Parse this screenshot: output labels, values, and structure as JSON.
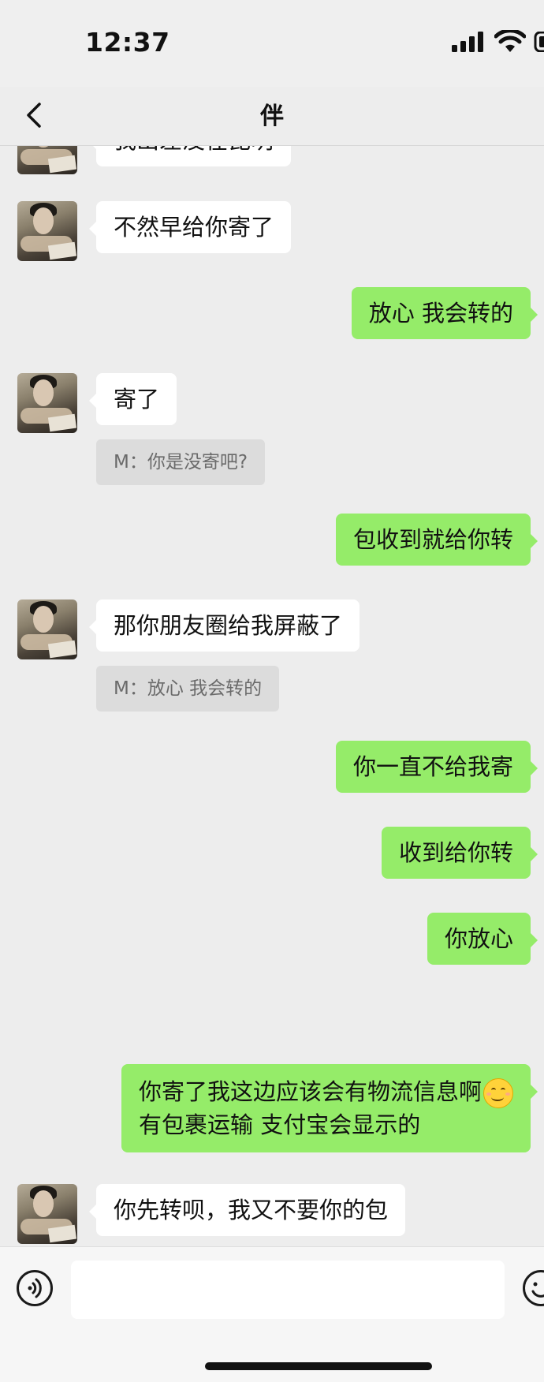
{
  "status_bar": {
    "time": "12:37"
  },
  "header": {
    "title": "伴",
    "back_icon": "chevron-left-icon"
  },
  "messages": [
    {
      "side": "in",
      "text": "我出差没在昆明",
      "cut": true
    },
    {
      "side": "in",
      "text": "不然早给你寄了"
    },
    {
      "side": "out",
      "text": "放心 我会转的"
    },
    {
      "side": "in",
      "text": "寄了",
      "quote": "M：你是没寄吧?"
    },
    {
      "side": "out",
      "text": "包收到就给你转"
    },
    {
      "side": "in",
      "text": "那你朋友圈给我屏蔽了",
      "quote": "M：放心 我会转的"
    },
    {
      "side": "out",
      "text": "你一直不给我寄"
    },
    {
      "side": "out",
      "text": "收到给你转"
    },
    {
      "side": "out",
      "text": "你放心"
    },
    {
      "side": "out",
      "line1": "你寄了我这边应该会有物流信息啊",
      "line2": "有包裹运输 支付宝会显示的",
      "emoji": "smiling-face-emoji"
    },
    {
      "side": "in",
      "text": "你先转呗，我又不要你的包"
    }
  ],
  "input_bar": {
    "voice_icon": "voice-icon",
    "emoji_icon": "emoji-icon",
    "placeholder": ""
  },
  "colors": {
    "background": "#ededed",
    "outgoing_bubble": "#95ec69",
    "incoming_bubble": "#ffffff",
    "quote_bg": "#dcdcdc"
  }
}
